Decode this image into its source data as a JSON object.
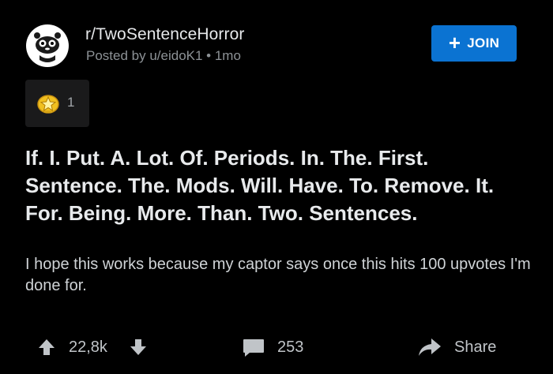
{
  "post": {
    "subreddit": "r/TwoSentenceHorror",
    "posted_by": "Posted by u/eidoK1 • 1mo",
    "join_label": "JOIN",
    "award_count": "1",
    "title": "If. I. Put. A. Lot. Of. Periods. In. The. First. Sentence. The. Mods. Will. Have. To. Remove. It. For. Being. More. Than. Two. Sentences.",
    "body": "I hope this works because my captor says once this hits 100 upvotes I'm done for."
  },
  "actions": {
    "vote_count": "22,8k",
    "comment_count": "253",
    "share_label": "Share"
  },
  "icons": {
    "avatar": "subreddit-avatar-icon",
    "join": "plus-icon",
    "award": "star-award-icon",
    "upvote": "arrow-up-icon",
    "downvote": "arrow-down-icon",
    "comment": "comment-bubble-icon",
    "share": "share-arrow-icon"
  },
  "colors": {
    "background": "#000000",
    "join_button": "#0b73d2",
    "award_box": "#1a1a1b",
    "award_star": "#f5c518"
  }
}
